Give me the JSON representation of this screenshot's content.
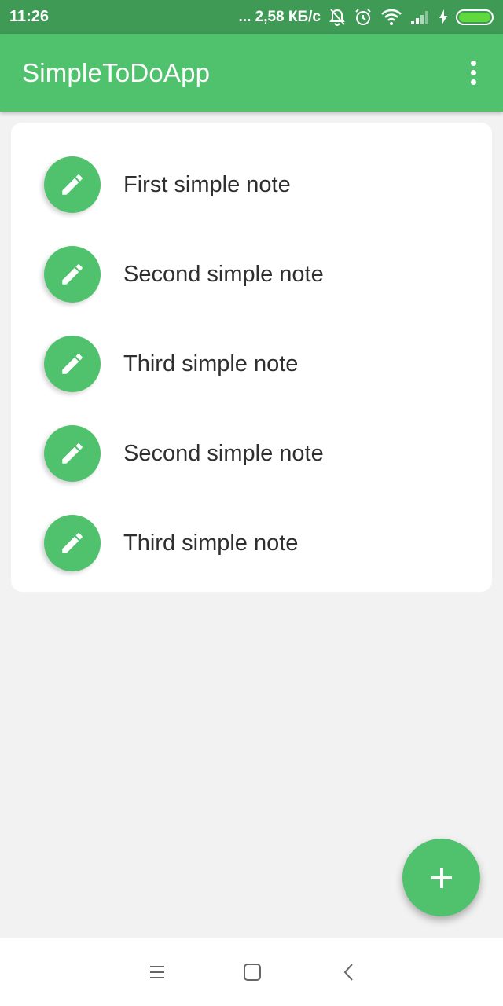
{
  "status_bar": {
    "time": "11:26",
    "network_speed": "... 2,58 КБ/с",
    "icons": [
      "bell-off-icon",
      "alarm-icon",
      "wifi-icon",
      "signal-icon",
      "charging-icon",
      "battery-icon"
    ]
  },
  "app_bar": {
    "title": "SimpleToDoApp",
    "menu_icon": "more-vert-icon"
  },
  "notes": [
    {
      "text": "First simple note",
      "icon": "pencil-icon"
    },
    {
      "text": "Second simple note",
      "icon": "pencil-icon"
    },
    {
      "text": "Third simple note",
      "icon": "pencil-icon"
    },
    {
      "text": "Second simple note",
      "icon": "pencil-icon"
    },
    {
      "text": "Third simple note",
      "icon": "pencil-icon"
    }
  ],
  "fab": {
    "icon": "plus-icon"
  },
  "nav_bar": {
    "icons": [
      "menu-icon",
      "home-icon",
      "back-icon"
    ]
  },
  "colors": {
    "primary": "#50c26e",
    "status_bar": "#3f9a56",
    "background": "#f2f2f2",
    "card": "#ffffff",
    "text": "#2f2f2f"
  }
}
